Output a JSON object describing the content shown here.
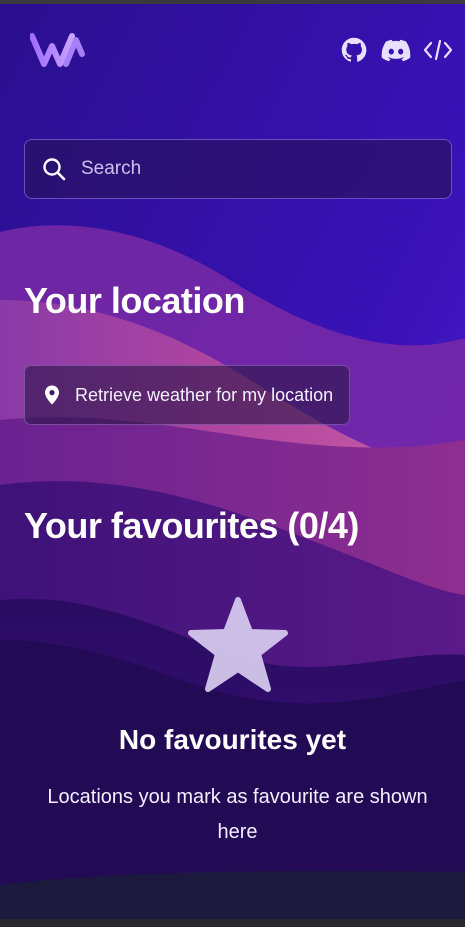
{
  "header": {
    "logo_icon": "weather-app-logo",
    "icons": [
      "github-icon",
      "discord-icon",
      "code-icon"
    ]
  },
  "search": {
    "placeholder": "Search",
    "value": ""
  },
  "location": {
    "title": "Your location",
    "button_label": "Retrieve weather for my location"
  },
  "favourites": {
    "title": "Your favourites (0/4)",
    "empty_title": "No favourites yet",
    "empty_text": "Locations you mark as favourite are shown here"
  },
  "colors": {
    "accent": "#6a3de8",
    "background_top": "#2c0d9a",
    "wave_pink": "#c0519a",
    "wave_dark": "#2a0c5e"
  }
}
